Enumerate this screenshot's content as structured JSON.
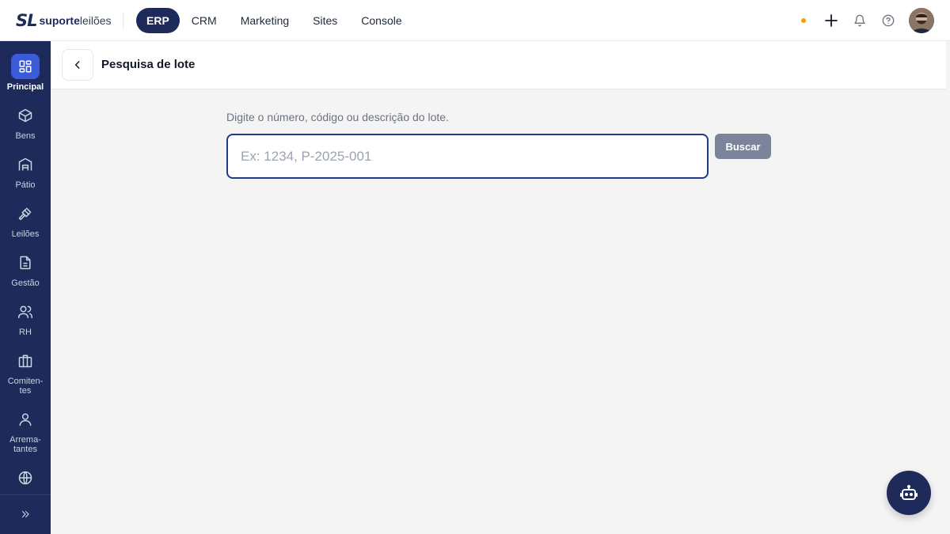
{
  "brand": {
    "mark": "SL",
    "name_bold": "suporte",
    "name_light": "leilões"
  },
  "nav": {
    "items": [
      {
        "label": "ERP",
        "active": true
      },
      {
        "label": "CRM",
        "active": false
      },
      {
        "label": "Marketing",
        "active": false
      },
      {
        "label": "Sites",
        "active": false
      },
      {
        "label": "Console",
        "active": false
      }
    ]
  },
  "topbar_icons": [
    "status-dot",
    "plus-icon",
    "bell-icon",
    "help-icon",
    "avatar"
  ],
  "sidebar": {
    "items": [
      {
        "label": "Principal",
        "icon": "grid-icon",
        "active": true
      },
      {
        "label": "Bens",
        "icon": "box-icon",
        "active": false
      },
      {
        "label": "Pátio",
        "icon": "warehouse-icon",
        "active": false
      },
      {
        "label": "Leilões",
        "icon": "gavel-icon",
        "active": false
      },
      {
        "label": "Gestão",
        "icon": "document-icon",
        "active": false
      },
      {
        "label": "RH",
        "icon": "users-icon",
        "active": false
      },
      {
        "label": "Comiten-\ntes",
        "icon": "briefcase-icon",
        "active": false
      },
      {
        "label": "Arrema-\ntantes",
        "icon": "user-icon",
        "active": false
      },
      {
        "label": "",
        "icon": "globe-icon",
        "active": false
      }
    ],
    "expand_icon": "chevrons-right-icon"
  },
  "page": {
    "title": "Pesquisa de lote",
    "hint": "Digite o número, código ou descrição do lote.",
    "search_placeholder": "Ex: 1234, P-2025-001",
    "search_value": "",
    "search_button": "Buscar"
  },
  "colors": {
    "sidebar_bg": "#1e2a5a",
    "accent": "#3b5bdb",
    "nav_active_bg": "#1e2a5a",
    "status_dot": "#f59e0b",
    "button_disabled": "#7b849b"
  }
}
